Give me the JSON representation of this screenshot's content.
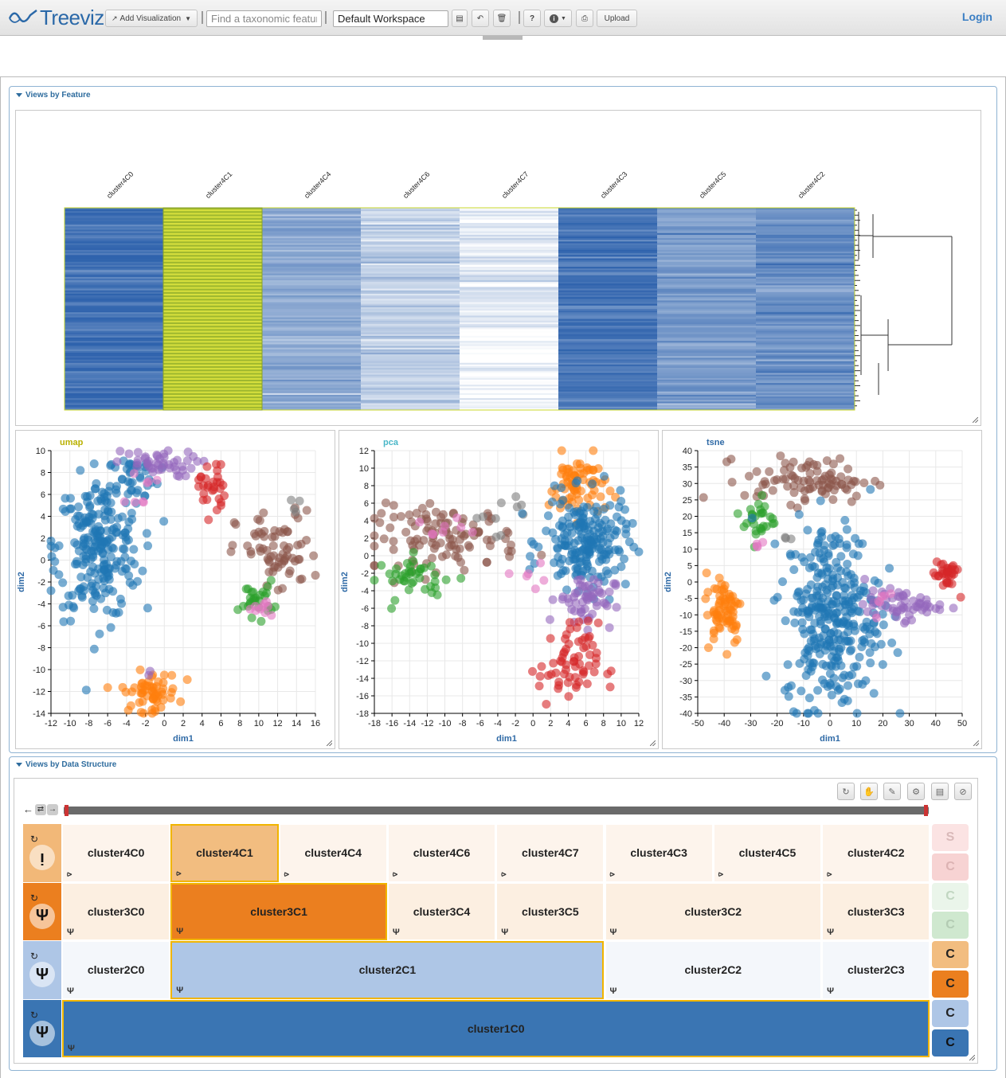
{
  "app": {
    "logo_text": "Treeviz"
  },
  "toolbar": {
    "add_visualization": "Add Visualization",
    "search_placeholder": "Find a taxonomic feature",
    "workspace_value": "Default Workspace",
    "help": "?",
    "upload": "Upload",
    "login": "Login",
    "icons": [
      "chart-add-icon",
      "save-icon",
      "undo-icon",
      "trash-icon",
      "help-icon",
      "info-icon",
      "print-icon"
    ]
  },
  "sections": {
    "features_title": "Views by Feature",
    "structure_title": "Views by Data Structure"
  },
  "heatmap": {
    "columns": [
      "cluster4C0",
      "cluster4C1",
      "cluster4C4",
      "cluster4C6",
      "cluster4C7",
      "cluster4C3",
      "cluster4C5",
      "cluster4C2"
    ],
    "highlighted_column": "cluster4C1",
    "colors": {
      "high": "#2f63ad",
      "low": "#ffffff",
      "highlight": "#c9d72a"
    }
  },
  "chart_data": [
    {
      "type": "scatter",
      "title": "umap",
      "title_color": "#b9b100",
      "xlabel": "dim1",
      "ylabel": "dim2",
      "xlim": [
        -12,
        16
      ],
      "ylim": [
        -14,
        10
      ],
      "xticks": [
        -12,
        -10,
        -8,
        -6,
        -4,
        -2,
        0,
        2,
        4,
        6,
        8,
        10,
        12,
        14,
        16
      ],
      "yticks": [
        -14,
        -12,
        -10,
        -8,
        -6,
        -4,
        -2,
        0,
        2,
        4,
        6,
        8,
        10
      ],
      "groups": [
        {
          "color": "#1f77b4",
          "cx": -7,
          "cy": 1,
          "sx": 2.2,
          "sy": 3.2,
          "n": 230
        },
        {
          "color": "#1f77b4",
          "cx": -3.5,
          "cy": 7.5,
          "sx": 1.5,
          "sy": 1.2,
          "n": 40
        },
        {
          "color": "#9467bd",
          "cx": -1,
          "cy": 8.8,
          "sx": 2.2,
          "sy": 0.6,
          "n": 45
        },
        {
          "color": "#e377c2",
          "cx": -3,
          "cy": 6.5,
          "sx": 1.0,
          "sy": 0.8,
          "n": 8
        },
        {
          "color": "#d62728",
          "cx": 5,
          "cy": 6.8,
          "sx": 0.7,
          "sy": 1.4,
          "n": 30
        },
        {
          "color": "#8c564b",
          "cx": 12,
          "cy": 0.5,
          "sx": 2.2,
          "sy": 2.0,
          "n": 70
        },
        {
          "color": "#2ca02c",
          "cx": 9.8,
          "cy": -3.5,
          "sx": 0.9,
          "sy": 0.8,
          "n": 28
        },
        {
          "color": "#e377c2",
          "cx": 10.5,
          "cy": -4.5,
          "sx": 0.8,
          "sy": 0.5,
          "n": 10
        },
        {
          "color": "#7f7f7f",
          "cx": 14,
          "cy": 5,
          "sx": 0.3,
          "sy": 0.4,
          "n": 4
        },
        {
          "color": "#ff7f0e",
          "cx": -1.5,
          "cy": -12,
          "sx": 1.5,
          "sy": 0.9,
          "n": 60
        },
        {
          "color": "#9467bd",
          "cx": -1.3,
          "cy": -10.5,
          "sx": 0.3,
          "sy": 0.2,
          "n": 2
        }
      ]
    },
    {
      "type": "scatter",
      "title": "pca",
      "title_color": "#4ab7c8",
      "xlabel": "dim1",
      "ylabel": "dim2",
      "xlim": [
        -18,
        12
      ],
      "ylim": [
        -18,
        12
      ],
      "xticks": [
        -18,
        -16,
        -14,
        -12,
        -10,
        -8,
        -6,
        -4,
        -2,
        0,
        2,
        4,
        6,
        8,
        10,
        12
      ],
      "yticks": [
        -18,
        -16,
        -14,
        -12,
        -10,
        -8,
        -6,
        -4,
        -2,
        0,
        2,
        4,
        6,
        8,
        10,
        12
      ],
      "groups": [
        {
          "color": "#8c564b",
          "cx": -10,
          "cy": 2,
          "sx": 4.2,
          "sy": 1.8,
          "n": 110
        },
        {
          "color": "#2ca02c",
          "cx": -13,
          "cy": -2.5,
          "sx": 2.4,
          "sy": 1.2,
          "n": 40
        },
        {
          "color": "#e377c2",
          "cx": -11,
          "cy": 3,
          "sx": 1.5,
          "sy": 1.0,
          "n": 8
        },
        {
          "color": "#7f7f7f",
          "cx": -4,
          "cy": 5,
          "sx": 1.8,
          "sy": 1.2,
          "n": 10
        },
        {
          "color": "#ff7f0e",
          "cx": 5,
          "cy": 8,
          "sx": 1.6,
          "sy": 1.8,
          "n": 70
        },
        {
          "color": "#1f77b4",
          "cx": 6,
          "cy": 1.5,
          "sx": 2.4,
          "sy": 2.6,
          "n": 200
        },
        {
          "color": "#9467bd",
          "cx": 6,
          "cy": -5,
          "sx": 1.6,
          "sy": 1.5,
          "n": 55
        },
        {
          "color": "#d62728",
          "cx": 4,
          "cy": -12.5,
          "sx": 1.7,
          "sy": 2.4,
          "n": 65
        },
        {
          "color": "#e377c2",
          "cx": 0,
          "cy": -2.5,
          "sx": 1.5,
          "sy": 1.0,
          "n": 6
        }
      ]
    },
    {
      "type": "scatter",
      "title": "tsne",
      "title_color": "#2f6aa6",
      "xlabel": "dim1",
      "ylabel": "dim2",
      "xlim": [
        -50,
        50
      ],
      "ylim": [
        -40,
        40
      ],
      "xticks": [
        -50,
        -40,
        -30,
        -20,
        -10,
        0,
        10,
        20,
        30,
        40,
        50
      ],
      "yticks": [
        -40,
        -35,
        -30,
        -25,
        -20,
        -15,
        -10,
        -5,
        0,
        5,
        10,
        15,
        20,
        25,
        30,
        35,
        40
      ],
      "groups": [
        {
          "color": "#8c564b",
          "cx": -8,
          "cy": 31,
          "sx": 12,
          "sy": 3.5,
          "n": 90
        },
        {
          "color": "#2ca02c",
          "cx": -27,
          "cy": 19,
          "sx": 3,
          "sy": 3.5,
          "n": 28
        },
        {
          "color": "#e377c2",
          "cx": -25,
          "cy": 11,
          "sx": 1.5,
          "sy": 1.0,
          "n": 4
        },
        {
          "color": "#7f7f7f",
          "cx": -15,
          "cy": 13,
          "sx": 1.5,
          "sy": 1.0,
          "n": 3
        },
        {
          "color": "#ff7f0e",
          "cx": -40,
          "cy": -8,
          "sx": 3.5,
          "sy": 5.5,
          "n": 70
        },
        {
          "color": "#1f77b4",
          "cx": 1,
          "cy": -10,
          "sx": 9,
          "sy": 14,
          "n": 330
        },
        {
          "color": "#9467bd",
          "cx": 27,
          "cy": -7,
          "sx": 7,
          "sy": 2.2,
          "n": 55
        },
        {
          "color": "#d62728",
          "cx": 44,
          "cy": 2.5,
          "sx": 2.4,
          "sy": 2.8,
          "n": 32
        },
        {
          "color": "#e377c2",
          "cx": 18,
          "cy": -5,
          "sx": 2.0,
          "sy": 2.0,
          "n": 6
        }
      ]
    }
  ],
  "icicle": {
    "levels": [
      {
        "level": 4,
        "color": "#f2b878",
        "icon": "leaf-node-icon",
        "nodes": [
          {
            "label": "cluster4C0",
            "span": 1,
            "fill": "#fdf4ec"
          },
          {
            "label": "cluster4C1",
            "span": 1,
            "fill": "#f2bd80",
            "selected": true
          },
          {
            "label": "cluster4C4",
            "span": 1,
            "fill": "#fdf4ec"
          },
          {
            "label": "cluster4C6",
            "span": 1,
            "fill": "#fdf4ec"
          },
          {
            "label": "cluster4C7",
            "span": 1,
            "fill": "#fdf4ec"
          },
          {
            "label": "cluster4C3",
            "span": 1,
            "fill": "#fdf4ec"
          },
          {
            "label": "cluster4C5",
            "span": 1,
            "fill": "#fdf4ec"
          },
          {
            "label": "cluster4C2",
            "span": 1,
            "fill": "#fdf4ec"
          }
        ]
      },
      {
        "level": 3,
        "color": "#eb7f1f",
        "icon": "branch-node-icon",
        "nodes": [
          {
            "label": "cluster3C0",
            "span": 1,
            "fill": "#fcefe1"
          },
          {
            "label": "cluster3C1",
            "span": 2,
            "fill": "#eb7f1f",
            "selected": true
          },
          {
            "label": "cluster3C4",
            "span": 1,
            "fill": "#fcefe1"
          },
          {
            "label": "cluster3C5",
            "span": 1,
            "fill": "#fcefe1"
          },
          {
            "label": "cluster3C2",
            "span": 2,
            "fill": "#fcefe1"
          },
          {
            "label": "cluster3C3",
            "span": 1,
            "fill": "#fcefe1"
          }
        ]
      },
      {
        "level": 2,
        "color": "#aec6e6",
        "icon": "branch-node-icon",
        "nodes": [
          {
            "label": "cluster2C0",
            "span": 1,
            "fill": "#f4f7fb"
          },
          {
            "label": "cluster2C1",
            "span": 4,
            "fill": "#aec6e6",
            "selected": true
          },
          {
            "label": "cluster2C2",
            "span": 2,
            "fill": "#f4f7fb"
          },
          {
            "label": "cluster2C3",
            "span": 1,
            "fill": "#f4f7fb"
          }
        ]
      },
      {
        "level": 1,
        "color": "#3a75b3",
        "icon": "branch-node-icon",
        "nodes": [
          {
            "label": "cluster1C0",
            "span": 8,
            "fill": "#3a75b3",
            "selected": true
          }
        ]
      }
    ],
    "side_buttons": [
      {
        "label": "S",
        "bg": "#fbe3e3",
        "fg": "#d9b9b9"
      },
      {
        "label": "C",
        "bg": "#f7d3d3",
        "fg": "#dcb3b3"
      },
      {
        "label": "C",
        "bg": "#eaf5ea",
        "fg": "#c1d6c1"
      },
      {
        "label": "C",
        "bg": "#cfe8cf",
        "fg": "#b3cbb3"
      },
      {
        "label": "C",
        "bg": "#f2bd80",
        "fg": "#222222"
      },
      {
        "label": "C",
        "bg": "#eb7f1f",
        "fg": "#222222"
      },
      {
        "label": "C",
        "bg": "#aec6e6",
        "fg": "#222222"
      },
      {
        "label": "C",
        "bg": "#3a75b3",
        "fg": "#111111"
      }
    ],
    "controls": [
      "refresh-icon",
      "hand-icon",
      "pencil-icon",
      "settings-icon",
      "save-icon",
      "block-icon"
    ]
  }
}
